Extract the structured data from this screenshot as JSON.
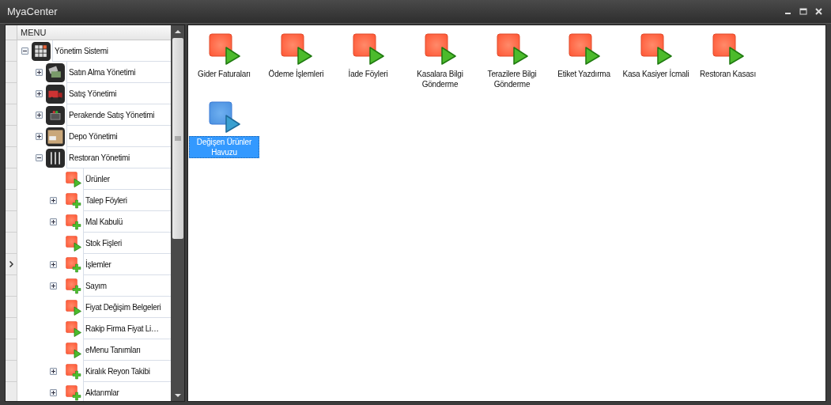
{
  "window": {
    "title": "MyaCenter"
  },
  "menu": {
    "header": "MENU",
    "items": [
      {
        "label": "Yönetim Sistemi",
        "kind": "grid",
        "expanded": true,
        "focused": false,
        "children": [
          {
            "label": "Satın Alma Yönetimi",
            "kind": "tags",
            "expanded": false,
            "focused": false
          },
          {
            "label": "Satış Yönetimi",
            "kind": "truck",
            "expanded": false,
            "focused": false
          },
          {
            "label": "Perakende Satış Yönetimi",
            "kind": "basket",
            "expanded": false,
            "focused": false
          },
          {
            "label": "Depo Yönetimi",
            "kind": "box",
            "expanded": false,
            "focused": false
          },
          {
            "label": "Restoran Yönetimi",
            "kind": "cutlery",
            "expanded": true,
            "focused": false,
            "children": [
              {
                "label": "Ürünler",
                "kind": "play",
                "focused": false
              },
              {
                "label": "Talep Föyleri",
                "kind": "plus",
                "expanded": false,
                "focused": false
              },
              {
                "label": "Mal Kabulü",
                "kind": "plus",
                "expanded": false,
                "focused": false
              },
              {
                "label": "Stok Fişleri",
                "kind": "play",
                "focused": false
              },
              {
                "label": "İşlemler",
                "kind": "plus",
                "expanded": false,
                "focused": true
              },
              {
                "label": "Sayım",
                "kind": "plus",
                "expanded": false,
                "focused": false
              },
              {
                "label": "Fiyat Değişim Belgeleri",
                "kind": "play",
                "focused": false
              },
              {
                "label": "Rakip Firma Fiyat Li…",
                "kind": "play",
                "focused": false
              },
              {
                "label": "eMenu Tanımları",
                "kind": "play",
                "focused": false
              },
              {
                "label": "Kiralık Reyon Takibi",
                "kind": "plus",
                "expanded": false,
                "focused": false
              },
              {
                "label": "Aktarımlar",
                "kind": "plus",
                "expanded": false,
                "focused": false
              }
            ]
          }
        ]
      }
    ]
  },
  "tiles": [
    {
      "label": "Gider Faturaları",
      "selected": false
    },
    {
      "label": "Ödeme İşlemleri",
      "selected": false
    },
    {
      "label": "İade Föyleri",
      "selected": false
    },
    {
      "label": "Kasalara Bilgi Gönderme",
      "selected": false
    },
    {
      "label": "Terazilere Bilgi Gönderme",
      "selected": false
    },
    {
      "label": "Etiket Yazdırma",
      "selected": false
    },
    {
      "label": "Kasa Kasiyer İcmali",
      "selected": false
    },
    {
      "label": "Restoran Kasası",
      "selected": false
    },
    {
      "label": "Değişen Ürünler Havuzu",
      "selected": true
    }
  ]
}
